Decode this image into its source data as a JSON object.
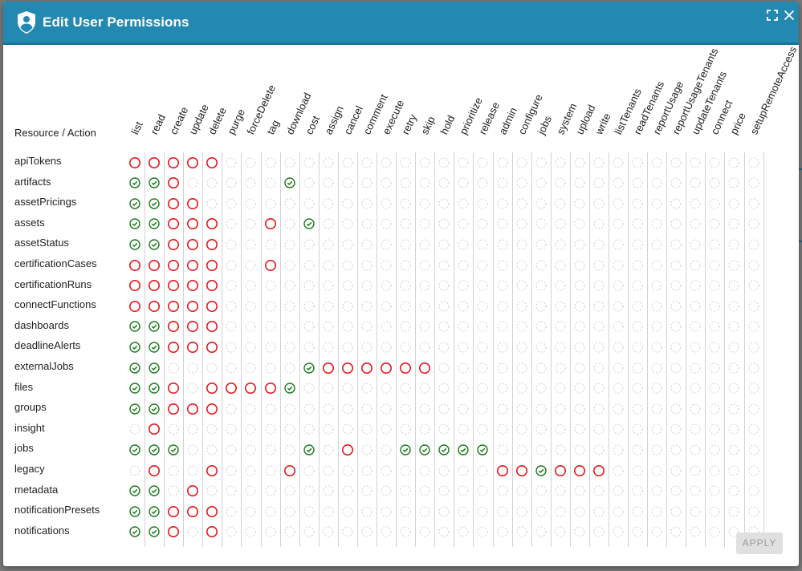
{
  "dialog": {
    "title": "Edit User Permissions",
    "title_icon": "user-shield-icon",
    "maximize_icon": "maximize-icon",
    "close_icon": "close-icon",
    "apply_label": "APPLY",
    "apply_enabled": false
  },
  "colors": {
    "titlebar": "#2389b0",
    "granted": "#1a7a1a",
    "denied": "#e8161b",
    "unset": "#cfcfcf"
  },
  "legend": {
    "g": "granted (green check)",
    "d": "denied (red circle)",
    "": "not set (dashed gray circle)"
  },
  "grid": {
    "corner_label": "Resource / Action",
    "actions": [
      "list",
      "read",
      "create",
      "update",
      "delete",
      "purge",
      "forceDelete",
      "tag",
      "download",
      "cost",
      "assign",
      "cancel",
      "comment",
      "execute",
      "retry",
      "skip",
      "hold",
      "prioritize",
      "release",
      "admin",
      "configure",
      "jobs",
      "system",
      "upload",
      "write",
      "listTenants",
      "readTenants",
      "reportUsage",
      "reportUsageTenants",
      "updateTenants",
      "connect",
      "price",
      "setupRemoteAccess"
    ],
    "rows": [
      {
        "resource": "apiTokens",
        "cells": "ddddd............................"
      },
      {
        "resource": "artifacts",
        "cells": "ggd.....g........................"
      },
      {
        "resource": "assetPricings",
        "cells": "ggdd............................."
      },
      {
        "resource": "assets",
        "cells": "ggddd..d.g......................."
      },
      {
        "resource": "assetStatus",
        "cells": "ggddd............................"
      },
      {
        "resource": "certificationCases",
        "cells": "ddddd..d........................."
      },
      {
        "resource": "certificationRuns",
        "cells": "ddddd............................"
      },
      {
        "resource": "connectFunctions",
        "cells": "ddddd............................"
      },
      {
        "resource": "dashboards",
        "cells": "ggddd............................"
      },
      {
        "resource": "deadlineAlerts",
        "cells": "ggddd............................"
      },
      {
        "resource": "externalJobs",
        "cells": "gg.......gdddddd................."
      },
      {
        "resource": "files",
        "cells": "ggd.ddddg........................"
      },
      {
        "resource": "groups",
        "cells": "ggddd............................"
      },
      {
        "resource": "insight",
        "cells": ".d..............................."
      },
      {
        "resource": "jobs",
        "cells": "ggg......g.d..ggggg.............."
      },
      {
        "resource": "legacy",
        "cells": ".d..d...d..........ddgddd........"
      },
      {
        "resource": "metadata",
        "cells": "gg.d............................."
      },
      {
        "resource": "notificationPresets",
        "cells": "ggddd............................"
      },
      {
        "resource": "notifications",
        "cells": "ggd.d............................"
      }
    ]
  }
}
